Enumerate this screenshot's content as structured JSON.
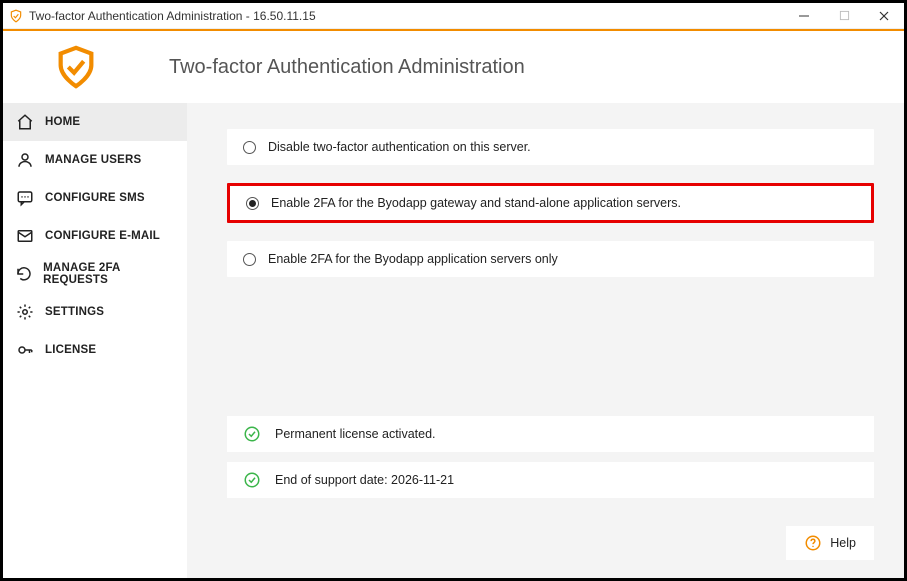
{
  "window": {
    "title": "Two-factor Authentication Administration - 16.50.11.15"
  },
  "header": {
    "title": "Two-factor Authentication Administration"
  },
  "sidebar": {
    "items": [
      {
        "label": "HOME"
      },
      {
        "label": "MANAGE USERS"
      },
      {
        "label": "CONFIGURE SMS"
      },
      {
        "label": "CONFIGURE E-MAIL"
      },
      {
        "label": "MANAGE 2FA REQUESTS"
      },
      {
        "label": "SETTINGS"
      },
      {
        "label": "LICENSE"
      }
    ]
  },
  "options": [
    {
      "label": "Disable two-factor authentication on this server."
    },
    {
      "label": "Enable 2FA for the Byodapp gateway and stand-alone application servers."
    },
    {
      "label": "Enable 2FA for the Byodapp application servers only"
    }
  ],
  "status": {
    "license": "Permanent license activated.",
    "support": "End of support date: 2026-11-21"
  },
  "help": {
    "label": "Help"
  },
  "colors": {
    "accent": "#f28c00",
    "ok": "#4caf50",
    "highlight": "#e60000"
  }
}
